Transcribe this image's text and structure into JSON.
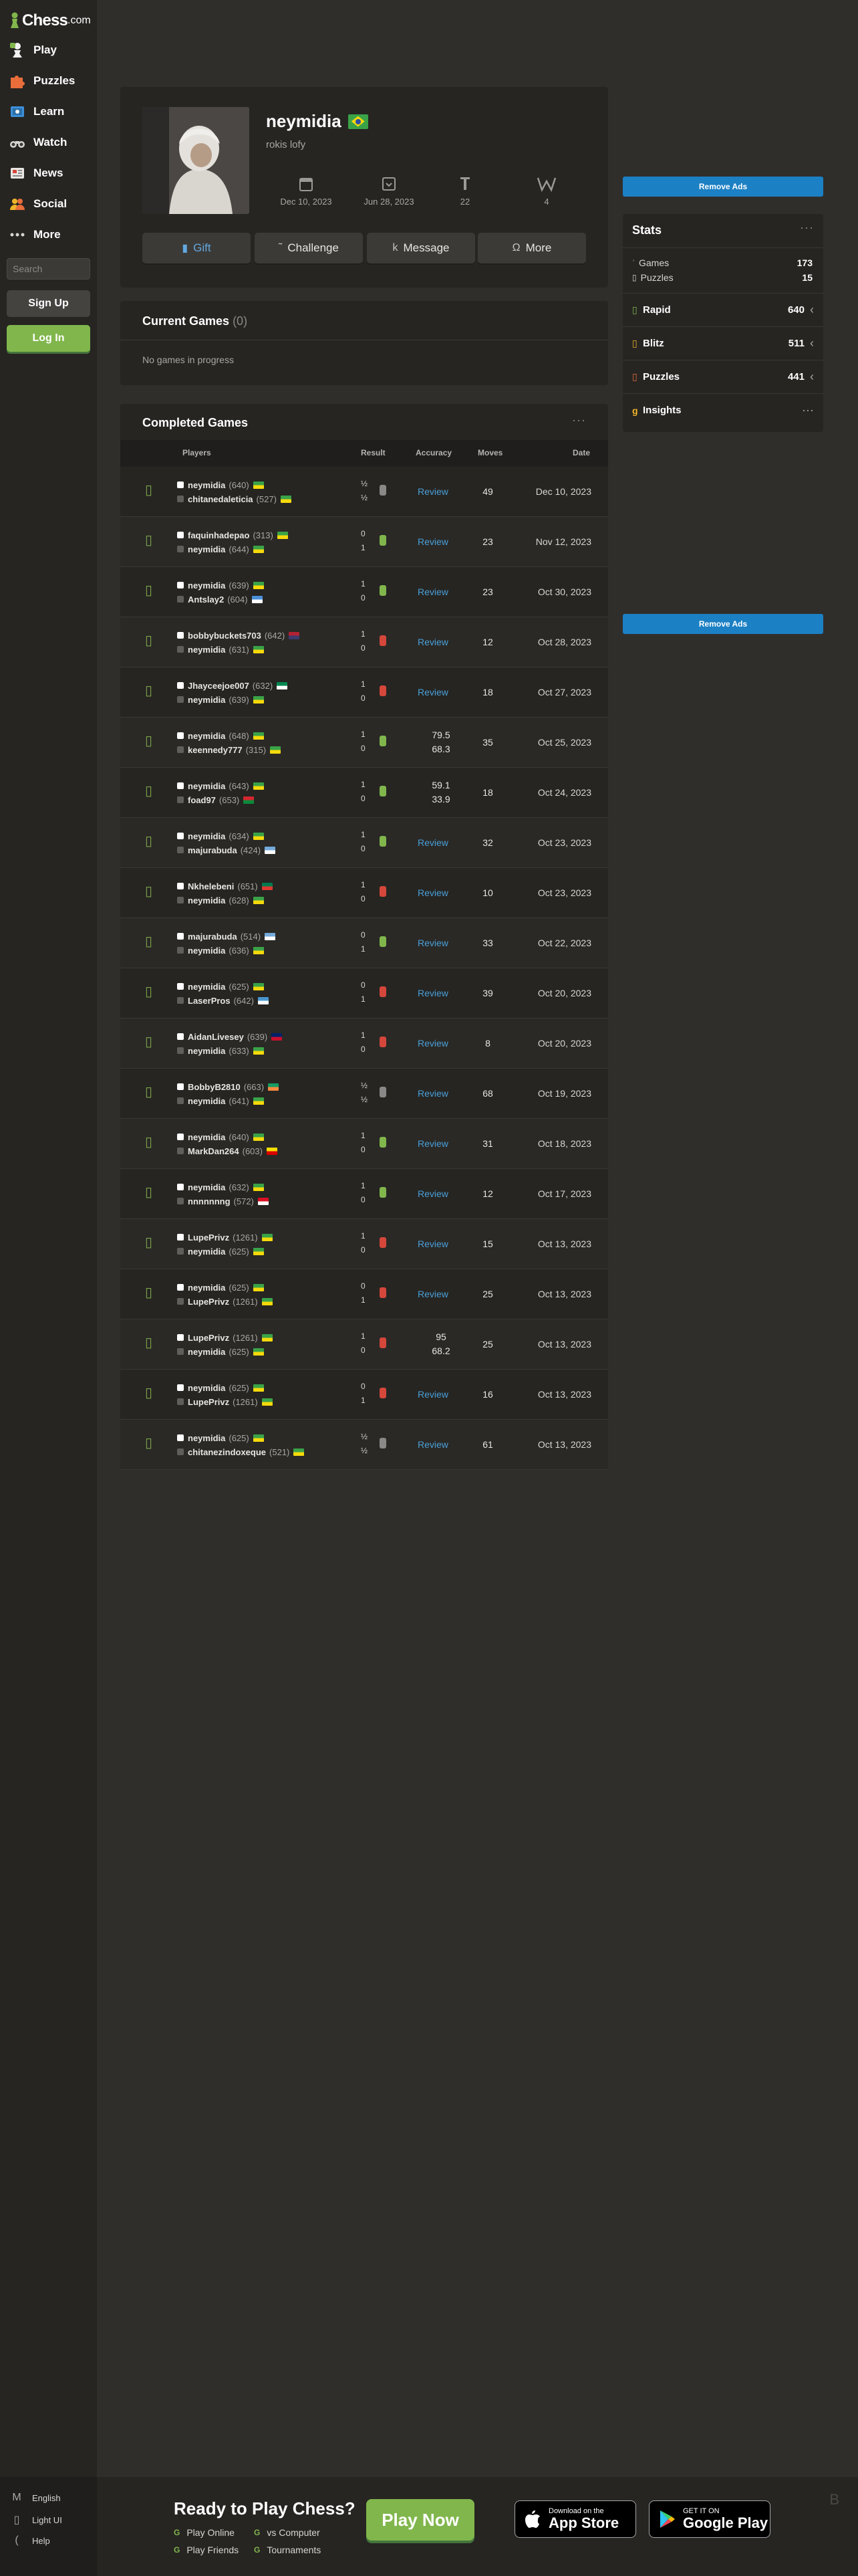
{
  "brand": {
    "logo_text": "Chess",
    "logo_suffix": ".com"
  },
  "sidebar": {
    "items": [
      {
        "label": "Play",
        "icon": "play-pawn-icon"
      },
      {
        "label": "Puzzles",
        "icon": "puzzle-icon"
      },
      {
        "label": "Learn",
        "icon": "learn-icon"
      },
      {
        "label": "Watch",
        "icon": "binoculars-icon"
      },
      {
        "label": "News",
        "icon": "news-icon"
      },
      {
        "label": "Social",
        "icon": "social-icon"
      },
      {
        "label": "More",
        "icon": "more-dots-icon"
      }
    ],
    "search_placeholder": "Search",
    "signup_label": "Sign Up",
    "login_label": "Log In"
  },
  "profile": {
    "username": "neymidia",
    "country": "Brazil",
    "bio": "rokis lofy",
    "joined": "Dec 10, 2023",
    "last_online": "Jun 28, 2023",
    "friends": "22",
    "views": "4",
    "buttons": {
      "gift": "Gift",
      "challenge": "Challenge",
      "message": "Message",
      "more": "More"
    }
  },
  "current_games": {
    "title": "Current Games",
    "count": "(0)",
    "empty_text": "No games in progress"
  },
  "completed_games": {
    "title": "Completed Games",
    "dots": "···",
    "headers": {
      "players": "Players",
      "result": "Result",
      "accuracy": "Accuracy",
      "moves": "Moves",
      "date": "Date"
    },
    "review_label": "Review",
    "rows": [
      {
        "white": {
          "name": "neymidia",
          "rating": "(640)",
          "flag": "br"
        },
        "black": {
          "name": "chitanedaleticia",
          "rating": "(527)",
          "flag": "br"
        },
        "r1": "½",
        "r2": "½",
        "outcome": "draw",
        "acc1": "",
        "acc2": "",
        "moves": "49",
        "date": "Dec 10, 2023"
      },
      {
        "white": {
          "name": "faquinhadepao",
          "rating": "(313)",
          "flag": "br"
        },
        "black": {
          "name": "neymidia",
          "rating": "(644)",
          "flag": "br"
        },
        "r1": "0",
        "r2": "1",
        "outcome": "win",
        "acc1": "",
        "acc2": "",
        "moves": "23",
        "date": "Nov 12, 2023"
      },
      {
        "white": {
          "name": "neymidia",
          "rating": "(639)",
          "flag": "br"
        },
        "black": {
          "name": "Antslay2",
          "rating": "(604)",
          "flag": "un"
        },
        "r1": "1",
        "r2": "0",
        "outcome": "win",
        "acc1": "",
        "acc2": "",
        "moves": "23",
        "date": "Oct 30, 2023"
      },
      {
        "white": {
          "name": "bobbybuckets703",
          "rating": "(642)",
          "flag": "us"
        },
        "black": {
          "name": "neymidia",
          "rating": "(631)",
          "flag": "br"
        },
        "r1": "1",
        "r2": "0",
        "outcome": "loss",
        "acc1": "",
        "acc2": "",
        "moves": "12",
        "date": "Oct 28, 2023"
      },
      {
        "white": {
          "name": "Jhayceejoe007",
          "rating": "(632)",
          "flag": "ng"
        },
        "black": {
          "name": "neymidia",
          "rating": "(639)",
          "flag": "br"
        },
        "r1": "1",
        "r2": "0",
        "outcome": "loss",
        "acc1": "",
        "acc2": "",
        "moves": "18",
        "date": "Oct 27, 2023"
      },
      {
        "white": {
          "name": "neymidia",
          "rating": "(648)",
          "flag": "br"
        },
        "black": {
          "name": "keennedy777",
          "rating": "(315)",
          "flag": "br"
        },
        "r1": "1",
        "r2": "0",
        "outcome": "win",
        "acc1": "79.5",
        "acc2": "68.3",
        "moves": "35",
        "date": "Oct 25, 2023"
      },
      {
        "white": {
          "name": "neymidia",
          "rating": "(643)",
          "flag": "br"
        },
        "black": {
          "name": "foad97",
          "rating": "(653)",
          "flag": "om"
        },
        "r1": "1",
        "r2": "0",
        "outcome": "win",
        "acc1": "59.1",
        "acc2": "33.9",
        "moves": "18",
        "date": "Oct 24, 2023"
      },
      {
        "white": {
          "name": "neymidia",
          "rating": "(634)",
          "flag": "br"
        },
        "black": {
          "name": "majurabuda",
          "rating": "(424)",
          "flag": "ar"
        },
        "r1": "1",
        "r2": "0",
        "outcome": "win",
        "acc1": "",
        "acc2": "",
        "moves": "32",
        "date": "Oct 23, 2023"
      },
      {
        "white": {
          "name": "Nkhelebeni",
          "rating": "(651)",
          "flag": "za"
        },
        "black": {
          "name": "neymidia",
          "rating": "(628)",
          "flag": "br"
        },
        "r1": "1",
        "r2": "0",
        "outcome": "loss",
        "acc1": "",
        "acc2": "",
        "moves": "10",
        "date": "Oct 23, 2023"
      },
      {
        "white": {
          "name": "majurabuda",
          "rating": "(514)",
          "flag": "ar"
        },
        "black": {
          "name": "neymidia",
          "rating": "(636)",
          "flag": "br"
        },
        "r1": "0",
        "r2": "1",
        "outcome": "win",
        "acc1": "",
        "acc2": "",
        "moves": "33",
        "date": "Oct 22, 2023"
      },
      {
        "white": {
          "name": "neymidia",
          "rating": "(625)",
          "flag": "br"
        },
        "black": {
          "name": "LaserPros",
          "rating": "(642)",
          "flag": "gt"
        },
        "r1": "0",
        "r2": "1",
        "outcome": "loss",
        "acc1": "",
        "acc2": "",
        "moves": "39",
        "date": "Oct 20, 2023"
      },
      {
        "white": {
          "name": "AidanLivesey",
          "rating": "(639)",
          "flag": "gb"
        },
        "black": {
          "name": "neymidia",
          "rating": "(633)",
          "flag": "br"
        },
        "r1": "1",
        "r2": "0",
        "outcome": "loss",
        "acc1": "",
        "acc2": "",
        "moves": "8",
        "date": "Oct 20, 2023"
      },
      {
        "white": {
          "name": "BobbyB2810",
          "rating": "(663)",
          "flag": "ie"
        },
        "black": {
          "name": "neymidia",
          "rating": "(641)",
          "flag": "br"
        },
        "r1": "½",
        "r2": "½",
        "outcome": "draw",
        "acc1": "",
        "acc2": "",
        "moves": "68",
        "date": "Oct 19, 2023"
      },
      {
        "white": {
          "name": "neymidia",
          "rating": "(640)",
          "flag": "br"
        },
        "black": {
          "name": "MarkDan264",
          "rating": "(603)",
          "flag": "ug"
        },
        "r1": "1",
        "r2": "0",
        "outcome": "win",
        "acc1": "",
        "acc2": "",
        "moves": "31",
        "date": "Oct 18, 2023"
      },
      {
        "white": {
          "name": "neymidia",
          "rating": "(632)",
          "flag": "br"
        },
        "black": {
          "name": "nnnnnnng",
          "rating": "(572)",
          "flag": "pe"
        },
        "r1": "1",
        "r2": "0",
        "outcome": "win",
        "acc1": "",
        "acc2": "",
        "moves": "12",
        "date": "Oct 17, 2023"
      },
      {
        "white": {
          "name": "LupePrivz",
          "rating": "(1261)",
          "flag": "br"
        },
        "black": {
          "name": "neymidia",
          "rating": "(625)",
          "flag": "br"
        },
        "r1": "1",
        "r2": "0",
        "outcome": "loss",
        "acc1": "",
        "acc2": "",
        "moves": "15",
        "date": "Oct 13, 2023"
      },
      {
        "white": {
          "name": "neymidia",
          "rating": "(625)",
          "flag": "br"
        },
        "black": {
          "name": "LupePrivz",
          "rating": "(1261)",
          "flag": "br"
        },
        "r1": "0",
        "r2": "1",
        "outcome": "loss",
        "acc1": "",
        "acc2": "",
        "moves": "25",
        "date": "Oct 13, 2023"
      },
      {
        "white": {
          "name": "LupePrivz",
          "rating": "(1261)",
          "flag": "br"
        },
        "black": {
          "name": "neymidia",
          "rating": "(625)",
          "flag": "br"
        },
        "r1": "1",
        "r2": "0",
        "outcome": "loss",
        "acc1": "95",
        "acc2": "68.2",
        "moves": "25",
        "date": "Oct 13, 2023"
      },
      {
        "white": {
          "name": "neymidia",
          "rating": "(625)",
          "flag": "br"
        },
        "black": {
          "name": "LupePrivz",
          "rating": "(1261)",
          "flag": "br"
        },
        "r1": "0",
        "r2": "1",
        "outcome": "loss",
        "acc1": "",
        "acc2": "",
        "moves": "16",
        "date": "Oct 13, 2023"
      },
      {
        "white": {
          "name": "neymidia",
          "rating": "(625)",
          "flag": "br"
        },
        "black": {
          "name": "chitanezindoxeque",
          "rating": "(521)",
          "flag": "br"
        },
        "r1": "½",
        "r2": "½",
        "outcome": "draw",
        "acc1": "",
        "acc2": "",
        "moves": "61",
        "date": "Oct 13, 2023"
      }
    ]
  },
  "right": {
    "remove_ads": "Remove Ads",
    "stats": {
      "title": "Stats",
      "dots": "···",
      "games_label": "Games",
      "games_value": "173",
      "puzzles_label": "Puzzles",
      "puzzles_value": "15",
      "categories": [
        {
          "label": "Rapid",
          "value": "640",
          "color": "#81b64c"
        },
        {
          "label": "Blitz",
          "value": "511",
          "color": "#f0b429"
        },
        {
          "label": "Puzzles",
          "value": "441",
          "color": "#e86d3a"
        }
      ],
      "insights_label": "Insights",
      "insights_dots": "···"
    }
  },
  "footer": {
    "language": "English",
    "theme": "Light UI",
    "help": "Help",
    "ready_title": "Ready to Play Chess?",
    "links": [
      "Play Online",
      "vs Computer",
      "Play Friends",
      "Tournaments"
    ],
    "play_now": "Play Now",
    "app_store_small": "Download on the",
    "app_store_big": "App Store",
    "google_small": "GET IT ON",
    "google_big": "Google Play"
  },
  "colors": {
    "accent_green": "#81b64c",
    "link_blue": "#4a9fd8",
    "ads_blue": "#1c80c4",
    "loss_red": "#d5473b"
  }
}
